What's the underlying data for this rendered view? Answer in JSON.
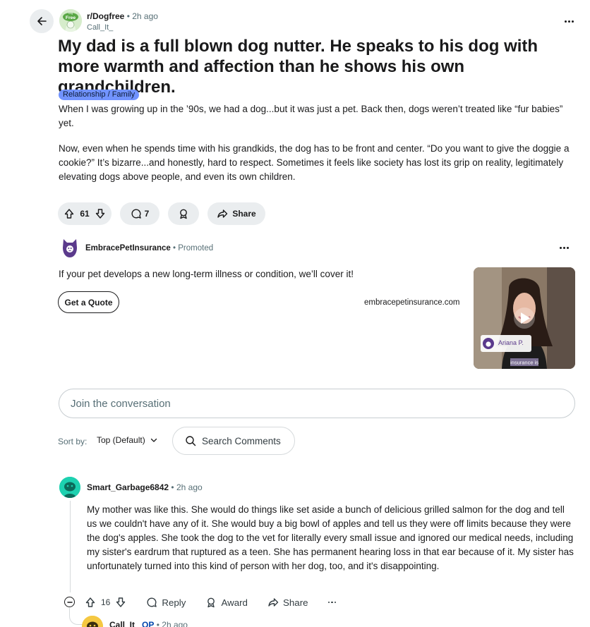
{
  "header": {
    "subreddit": "r/Dogfree",
    "subreddit_icon_text": "Dog Free",
    "separator": "•",
    "time": "2h ago",
    "author": "Call_It_"
  },
  "post": {
    "title": "My dad is a full blown dog nutter. He speaks to his dog with more warmth and affection than he shows his own grandchildren.",
    "flair": "Relationship / Family",
    "paragraphs": [
      "When I was growing up in the ’90s, we had a dog...but it was just a pet. Back then, dogs weren’t treated like “fur babies” yet.",
      "Now, even when he spends time with his grandkids, the dog has to be front and center. “Do you want to give the doggie a cookie?” It’s bizarre...and honestly, hard to respect. Sometimes it feels like society has lost its grip on reality, legitimately elevating dogs above people, and even its own children."
    ],
    "votes": "61",
    "comments": "7",
    "share_label": "Share"
  },
  "ad": {
    "advertiser": "EmbracePetInsurance",
    "separator": "•",
    "promoted": "Promoted",
    "headline": "If your pet develops a new long-term illness or condition, we’ll cover it!",
    "cta": "Get a Quote",
    "domain": "embracepetinsurance.com",
    "media_name": "Ariana P.",
    "media_caption": "insurance is"
  },
  "composer": {
    "placeholder": "Join the conversation"
  },
  "sort": {
    "label": "Sort by:",
    "value": "Top (Default)",
    "search_placeholder": "Search Comments"
  },
  "comments": [
    {
      "user": "Smart_Garbage6842",
      "separator": "•",
      "time": "2h ago",
      "body": "My mother was like this. She would do things like set aside a bunch of delicious grilled salmon for the dog and tell us we couldn't have any of it. She would buy a big bowl of apples and tell us they were off limits because they were the dog's apples. She took the dog to the vet for literally every small issue and ignored our medical needs, including my sister's eardrum that ruptured as a teen. She has permanent hearing loss in that ear because of it. My sister has unfortunately turned into this kind of person with her dog, too, and it's disappointing.",
      "votes": "16",
      "reply_label": "Reply",
      "award_label": "Award",
      "share_label": "Share"
    }
  ],
  "reply_preview": {
    "user": "Call_It_",
    "op_badge": "OP",
    "separator": "•",
    "time": "2h ago"
  },
  "colors": {
    "pill_bg": "#eaedef",
    "flair_bg": "#7193ff",
    "muted_text": "#576f76",
    "commenter_avatar": "#1dd1b0",
    "reply_avatar": "#f5c842",
    "op_badge": "#0045ac"
  }
}
